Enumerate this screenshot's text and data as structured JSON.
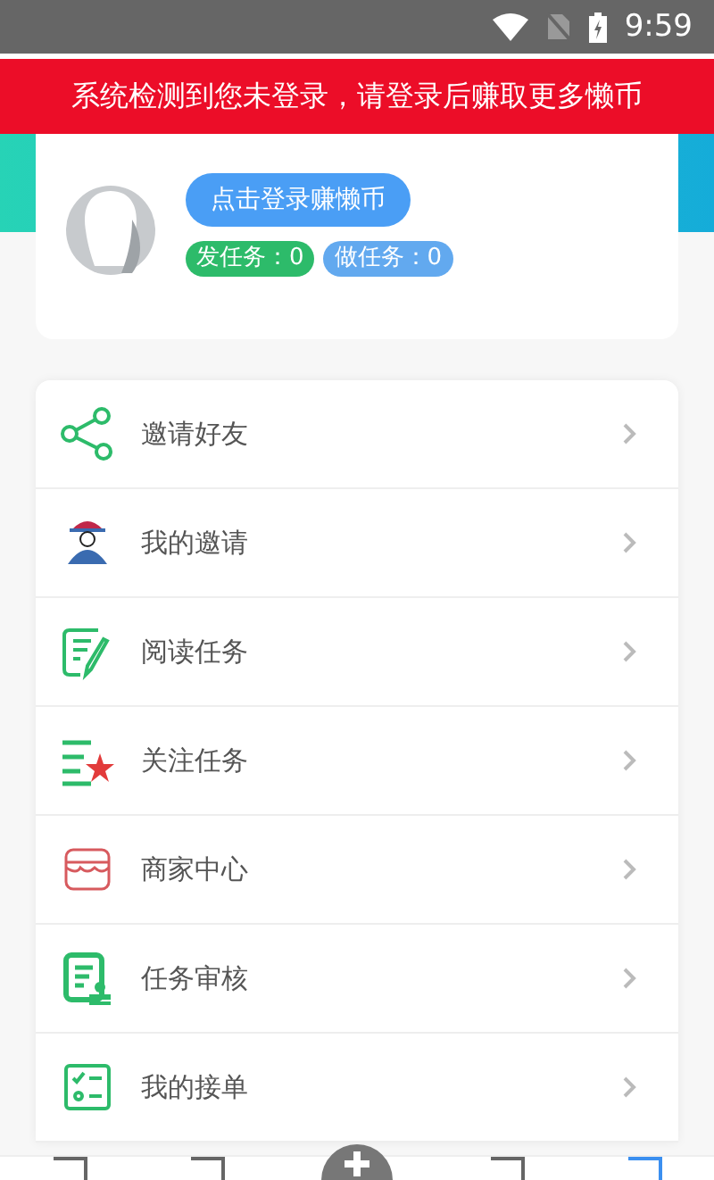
{
  "status_bar": {
    "time": "9:59"
  },
  "login_banner": {
    "text": "系统检测到您未登录，请登录后赚取更多懒币"
  },
  "profile": {
    "login_button": "点击登录赚懒币",
    "badges": [
      {
        "label": "发任务：0",
        "color": "#2dbb6a"
      },
      {
        "label": "做任务：0",
        "color": "#62a9ef"
      }
    ]
  },
  "menu": [
    {
      "label": "邀请好友"
    },
    {
      "label": "我的邀请"
    },
    {
      "label": "阅读任务"
    },
    {
      "label": "关注任务"
    },
    {
      "label": "商家中心"
    },
    {
      "label": "任务审核"
    },
    {
      "label": "我的接单"
    }
  ],
  "tab_bar": {
    "tabs": [
      {
        "selected": false
      },
      {
        "selected": false
      },
      {
        "selected": false
      },
      {
        "selected": false
      },
      {
        "selected": true
      }
    ]
  }
}
